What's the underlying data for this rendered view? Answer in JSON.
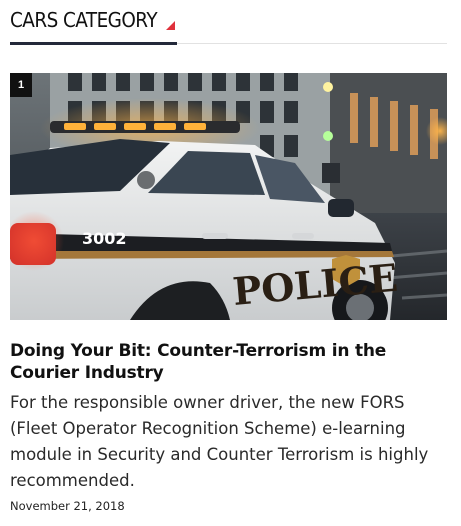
{
  "widget": {
    "title": "CARS CATEGORY",
    "accent_color": "#e0323c",
    "underline_color": "#23293a"
  },
  "post": {
    "rank": "1",
    "image_icon": "police-car-image",
    "image_text": {
      "car_number": "3002",
      "door_lettering": "POLICE"
    },
    "title": "Doing Your Bit: Counter-Terrorism in the Courier Industry",
    "excerpt": "For the responsible owner driver, the new FORS (Fleet Operator Recognition Scheme) e-learning module in Security and Counter Terrorism is highly recommended.",
    "date": "November 21, 2018"
  }
}
